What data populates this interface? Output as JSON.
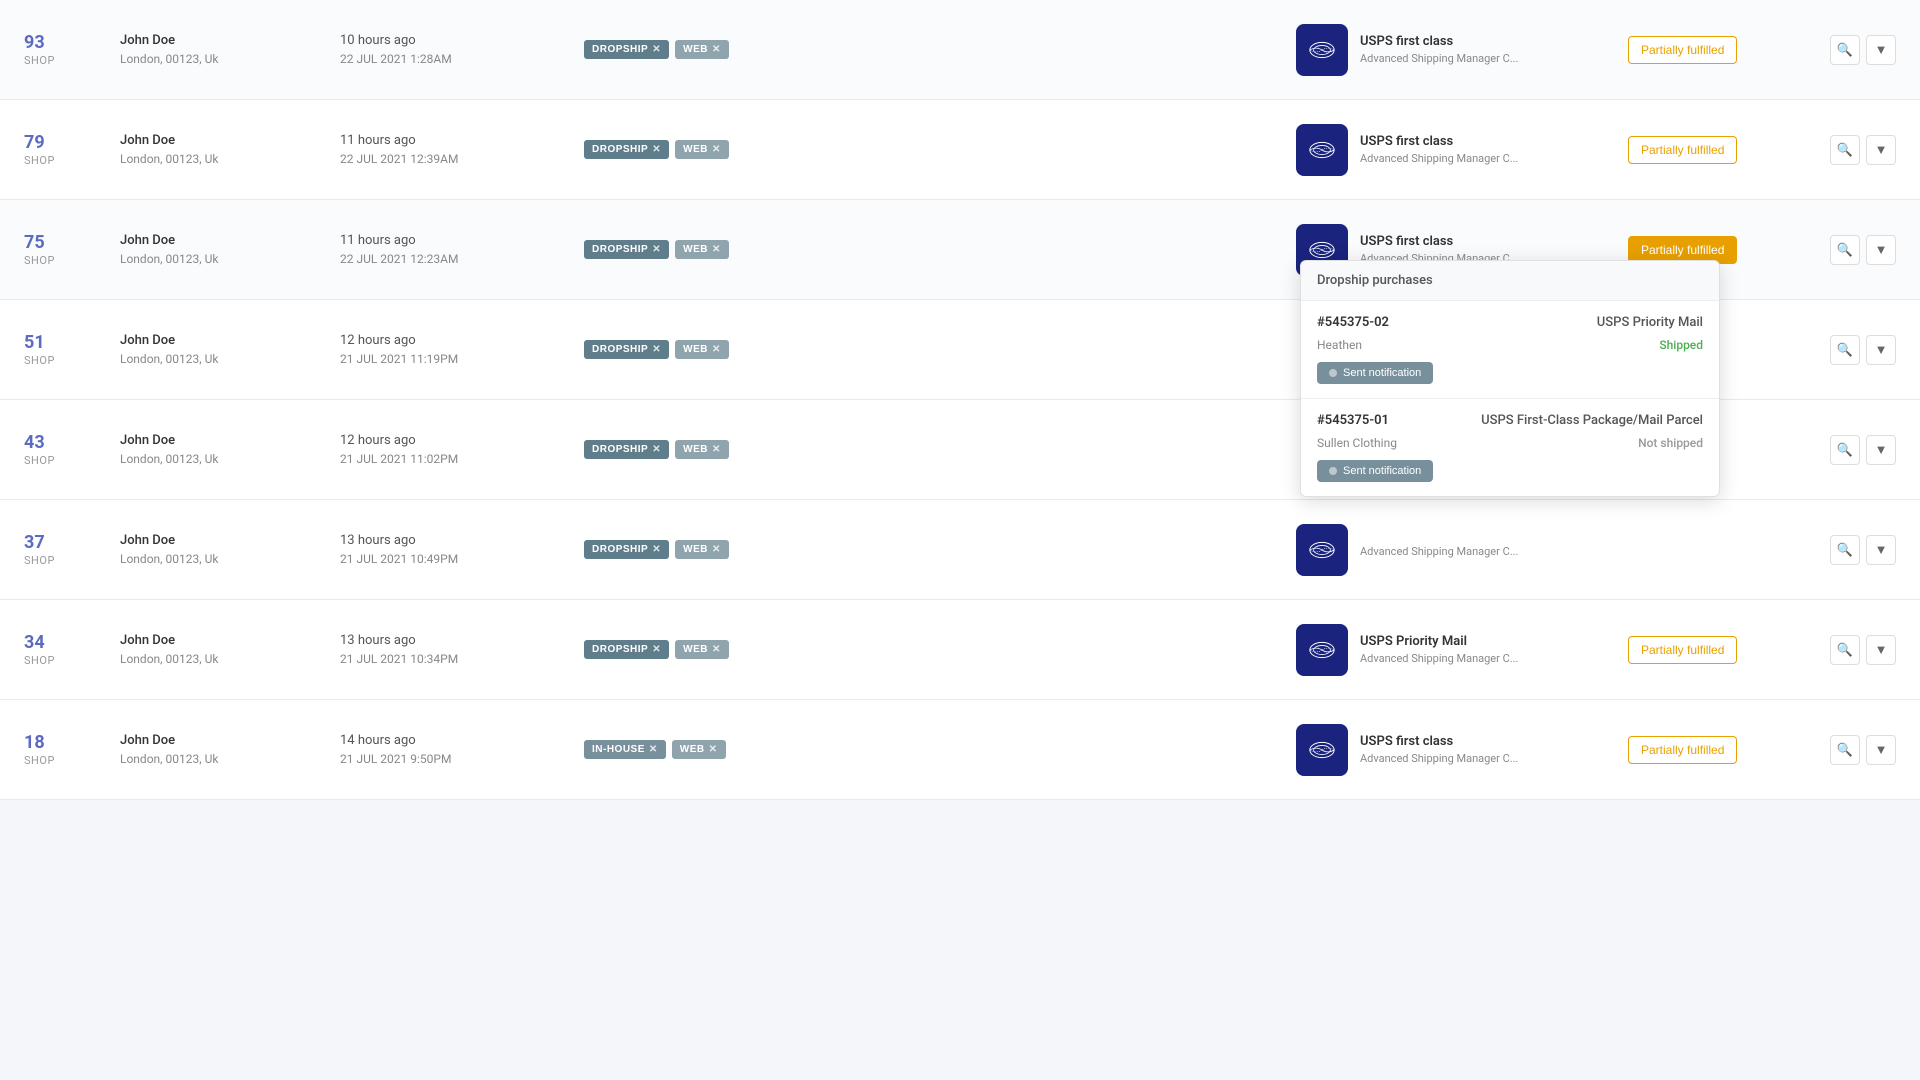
{
  "orders": [
    {
      "id": "93",
      "source": "SHOP",
      "customer": "John Doe",
      "address": "London, 00123, Uk",
      "time_ago": "10 hours ago",
      "date": "22 JUL 2021 1:28AM",
      "tags": [
        "DROPSHIP",
        "WEB"
      ],
      "carrier": "usps",
      "shipping_method": "USPS first class",
      "shipping_manager": "Advanced Shipping Manager C...",
      "status": "Partially fulfilled",
      "status_type": "partial",
      "has_dropdown": false
    },
    {
      "id": "79",
      "source": "SHOP",
      "customer": "John Doe",
      "address": "London, 00123, Uk",
      "time_ago": "11 hours ago",
      "date": "22 JUL 2021 12:39AM",
      "tags": [
        "DROPSHIP",
        "WEB"
      ],
      "carrier": "usps",
      "shipping_method": "USPS first class",
      "shipping_manager": "Advanced Shipping Manager C...",
      "status": "Partially fulfilled",
      "status_type": "partial",
      "has_dropdown": false
    },
    {
      "id": "75",
      "source": "SHOP",
      "customer": "John Doe",
      "address": "London, 00123, Uk",
      "time_ago": "11 hours ago",
      "date": "22 JUL 2021 12:23AM",
      "tags": [
        "DROPSHIP",
        "WEB"
      ],
      "carrier": "usps",
      "shipping_method": "USPS first class",
      "shipping_manager": "Advanced Shipping Manager C...",
      "status": "Partially fulfilled",
      "status_type": "partial-active",
      "has_dropdown": true,
      "dropdown": {
        "title": "Dropship purchases",
        "purchases": [
          {
            "id": "#545375-02",
            "method": "USPS Priority Mail",
            "vendor": "Heathen",
            "ship_status": "Shipped",
            "ship_status_type": "shipped",
            "notification_label": "Sent notification"
          },
          {
            "id": "#545375-01",
            "method": "USPS First-Class Package/Mail Parcel",
            "vendor": "Sullen Clothing",
            "ship_status": "Not shipped",
            "ship_status_type": "notshipped",
            "notification_label": "Sent notification"
          }
        ]
      }
    },
    {
      "id": "51",
      "source": "SHOP",
      "customer": "John Doe",
      "address": "London, 00123, Uk",
      "time_ago": "12 hours ago",
      "date": "21 JUL 2021 11:19PM",
      "tags": [
        "DROPSHIP",
        "WEB"
      ],
      "carrier": "usps",
      "shipping_method": "",
      "shipping_manager": "",
      "status": "",
      "status_type": "none",
      "has_dropdown": false
    },
    {
      "id": "43",
      "source": "SHOP",
      "customer": "John Doe",
      "address": "London, 00123, Uk",
      "time_ago": "12 hours ago",
      "date": "21 JUL 2021 11:02PM",
      "tags": [
        "DROPSHIP",
        "WEB"
      ],
      "carrier": "usps",
      "shipping_method": "",
      "shipping_manager": "",
      "status": "",
      "status_type": "none",
      "has_dropdown": false
    },
    {
      "id": "37",
      "source": "SHOP",
      "customer": "John Doe",
      "address": "London, 00123, Uk",
      "time_ago": "13 hours ago",
      "date": "21 JUL 2021 10:49PM",
      "tags": [
        "DROPSHIP",
        "WEB"
      ],
      "carrier": "usps",
      "shipping_method": "Advanced Shipping Manager C...",
      "shipping_manager": "",
      "status": "",
      "status_type": "none",
      "has_dropdown": false
    },
    {
      "id": "34",
      "source": "SHOP",
      "customer": "John Doe",
      "address": "London, 00123, Uk",
      "time_ago": "13 hours ago",
      "date": "21 JUL 2021 10:34PM",
      "tags": [
        "DROPSHIP",
        "WEB"
      ],
      "carrier": "usps",
      "shipping_method": "USPS Priority Mail",
      "shipping_manager": "Advanced Shipping Manager C...",
      "status": "Partially fulfilled",
      "status_type": "partial",
      "has_dropdown": false
    },
    {
      "id": "18",
      "source": "SHOP",
      "customer": "John Doe",
      "address": "London, 00123, Uk",
      "time_ago": "14 hours ago",
      "date": "21 JUL 2021 9:50PM",
      "tags": [
        "IN-HOUSE",
        "WEB"
      ],
      "carrier": "usps",
      "shipping_method": "USPS first class",
      "shipping_manager": "Advanced Shipping Manager C...",
      "status": "Partially fulfilled",
      "status_type": "partial",
      "has_dropdown": false
    }
  ],
  "icons": {
    "search": "🔍",
    "chevron_down": "▾",
    "trash": "🗑",
    "dot": "●"
  }
}
